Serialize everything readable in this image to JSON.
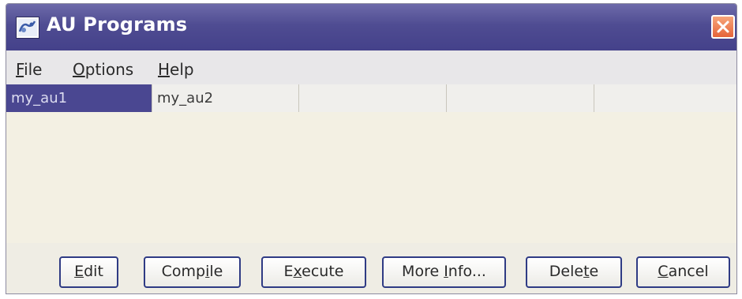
{
  "window": {
    "title": "AU Programs"
  },
  "menu": {
    "file": {
      "mnemonic": "F",
      "rest": "ile"
    },
    "options": {
      "mnemonic": "O",
      "rest": "ptions"
    },
    "help": {
      "mnemonic": "H",
      "rest": "elp"
    }
  },
  "programs": {
    "items": [
      "my_au1",
      "my_au2",
      "",
      "",
      ""
    ],
    "selected_index": 0
  },
  "buttons": {
    "edit": {
      "mnemonic": "E",
      "rest": "dit"
    },
    "compile": {
      "pre": "Comp",
      "mnemonic": "i",
      "rest": "le"
    },
    "execute": {
      "pre": "E",
      "mnemonic": "x",
      "rest": "ecute"
    },
    "more_info": {
      "pre": "More ",
      "mnemonic": "I",
      "rest": "nfo..."
    },
    "delete": {
      "pre": "Dele",
      "mnemonic": "t",
      "rest": "e"
    },
    "cancel": {
      "mnemonic": "C",
      "rest": "ancel"
    }
  },
  "colors": {
    "titlebar": "#4f4c92",
    "selection": "#4a4791",
    "close_button": "#e5643a",
    "button_border": "#2f3b84"
  },
  "icons": {
    "app": "app-icon",
    "close": "close-icon"
  }
}
